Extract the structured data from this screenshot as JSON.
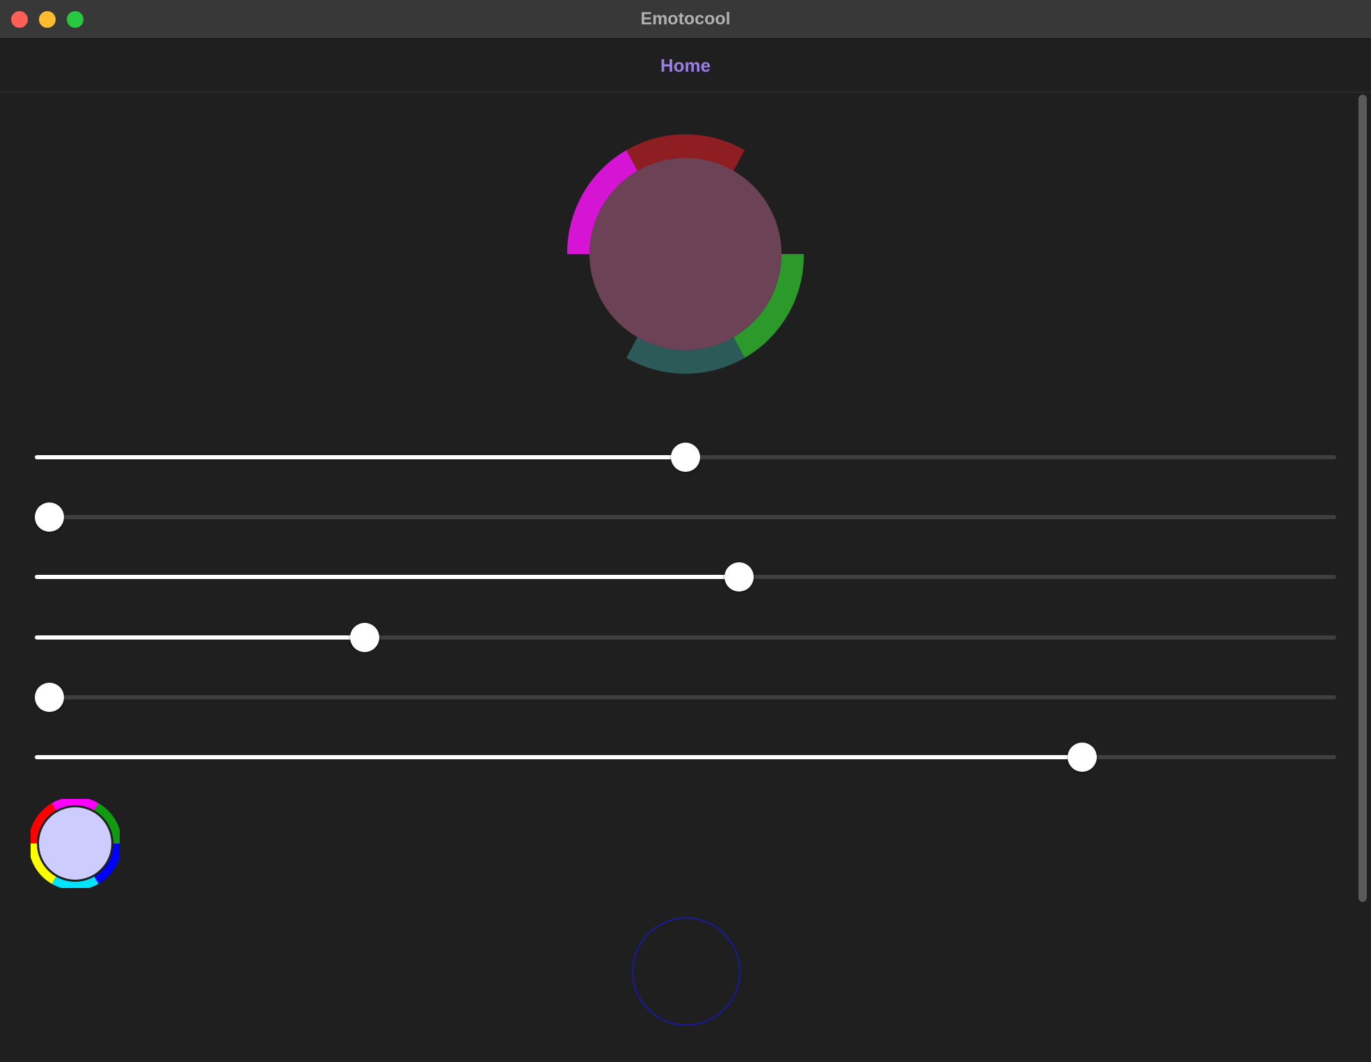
{
  "window": {
    "title": "Emotocool"
  },
  "nav": {
    "title": "Home"
  },
  "sliders": [
    {
      "value": 0.5
    },
    {
      "value": 0.0
    },
    {
      "value": 0.542
    },
    {
      "value": 0.248
    },
    {
      "value": 0.0
    },
    {
      "value": 0.812
    }
  ],
  "colors": {
    "title_text": "#b0b0b0",
    "nav_accent": "#9b7ee4",
    "background": "#1f1f1f",
    "main_circle": "#6b4256",
    "ring_red": "#8e1e22",
    "ring_magenta": "#d615d4",
    "ring_green": "#2b9a2b",
    "ring_teal": "#2b5a58",
    "small_circle": "#ccccff",
    "outline_circle": "#1a1aa0"
  },
  "icons": [
    "window-close-icon",
    "window-minimize-icon",
    "window-zoom-icon",
    "color-wheel-icon"
  ]
}
